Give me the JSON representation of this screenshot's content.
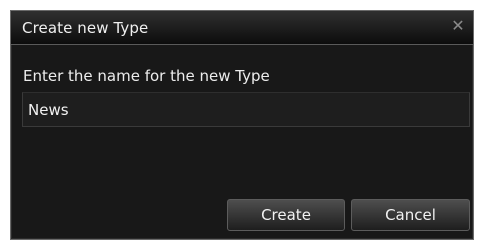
{
  "dialog": {
    "title": "Create new Type",
    "close_glyph": "✕",
    "prompt": "Enter the name for the new Type",
    "name_value": "News",
    "create_label": "Create",
    "cancel_label": "Cancel"
  },
  "icons": {
    "close": "close-icon"
  },
  "colors": {
    "background": "#181818",
    "text": "#f0f0f0",
    "close_icon": "#8a8a8a"
  }
}
